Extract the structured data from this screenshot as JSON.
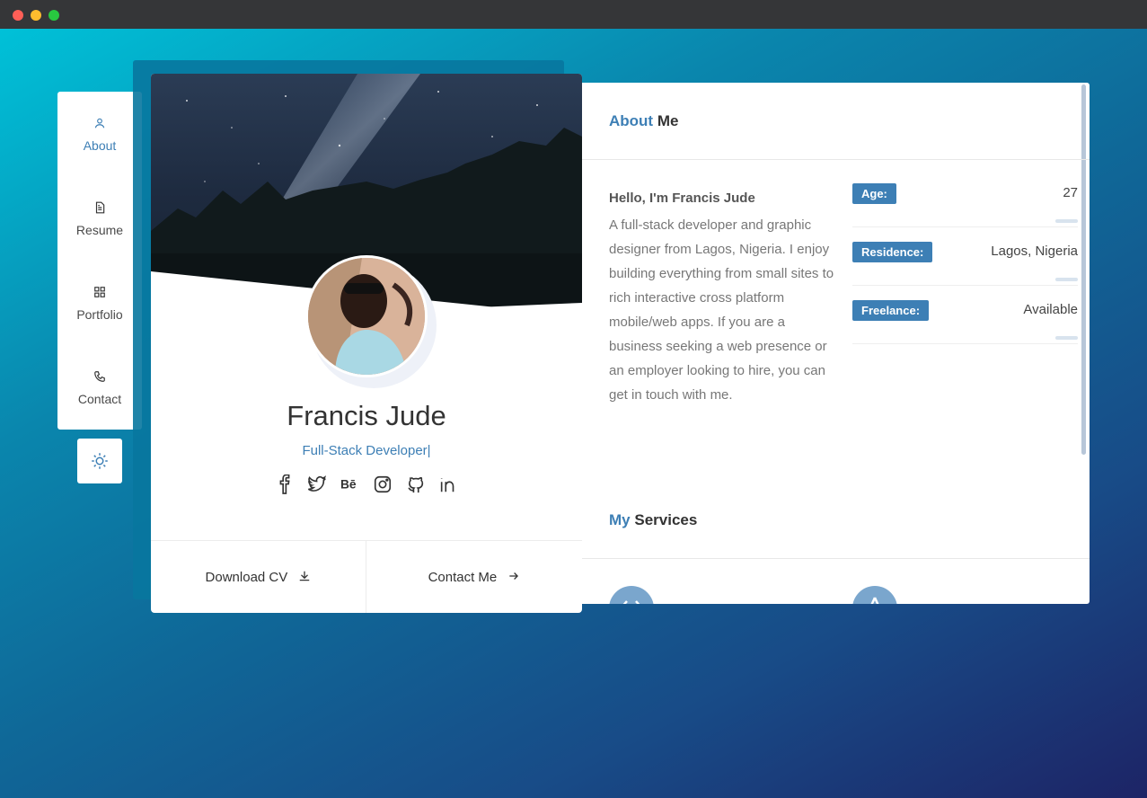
{
  "nav": {
    "items": [
      {
        "label": "About",
        "icon": "user-icon",
        "active": true
      },
      {
        "label": "Resume",
        "icon": "document-icon",
        "active": false
      },
      {
        "label": "Portfolio",
        "icon": "grid-icon",
        "active": false
      },
      {
        "label": "Contact",
        "icon": "phone-icon",
        "active": false
      }
    ],
    "theme_icon": "sun-icon"
  },
  "profile": {
    "name": "Francis Jude",
    "role": "Full-Stack Developer|",
    "socials": [
      "facebook-icon",
      "twitter-icon",
      "behance-icon",
      "instagram-icon",
      "github-icon",
      "linkedin-icon"
    ],
    "download_label": "Download CV",
    "contact_label": "Contact Me"
  },
  "about": {
    "title_accent": "About",
    "title_rest": "Me",
    "greeting": "Hello, I'm Francis Jude",
    "bio": "A full-stack developer and graphic designer from Lagos, Nigeria. I enjoy building everything from small sites to rich interactive cross platform mobile/web apps. If you are a business seeking a web presence or an employer looking to hire, you can get in touch with me.",
    "info": [
      {
        "label": "Age:",
        "value": "27"
      },
      {
        "label": "Residence:",
        "value": "Lagos, Nigeria"
      },
      {
        "label": "Freelance:",
        "value": "Available"
      }
    ]
  },
  "services": {
    "title_accent": "My",
    "title_rest": "Services"
  },
  "colors": {
    "accent": "#3d7fb5",
    "badge": "#3d7fb5"
  }
}
